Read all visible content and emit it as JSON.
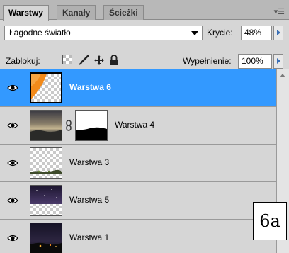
{
  "tabs": [
    {
      "label": "Warstwy",
      "active": true
    },
    {
      "label": "Kanały",
      "active": false
    },
    {
      "label": "Ścieżki",
      "active": false
    }
  ],
  "blend_mode": "Łagodne światło",
  "opacity": {
    "label": "Krycie:",
    "value": "48%"
  },
  "lock": {
    "label": "Zablokuj:",
    "icons": [
      "lock-transparency-icon",
      "lock-brush-icon",
      "lock-move-icon",
      "lock-all-icon"
    ]
  },
  "fill": {
    "label": "Wypełnienie:",
    "value": "100%"
  },
  "layers": [
    {
      "name": "Warstwa 6",
      "selected": true,
      "visible": true,
      "mask": false
    },
    {
      "name": "Warstwa 4",
      "selected": false,
      "visible": true,
      "mask": true
    },
    {
      "name": "Warstwa 3",
      "selected": false,
      "visible": true,
      "mask": false
    },
    {
      "name": "Warstwa 5",
      "selected": false,
      "visible": true,
      "mask": false
    },
    {
      "name": "Warstwa 1",
      "selected": false,
      "visible": true,
      "mask": false
    }
  ],
  "annotation": "6a",
  "colors": {
    "selection": "#3399ff",
    "panel": "#d6d6d6"
  }
}
